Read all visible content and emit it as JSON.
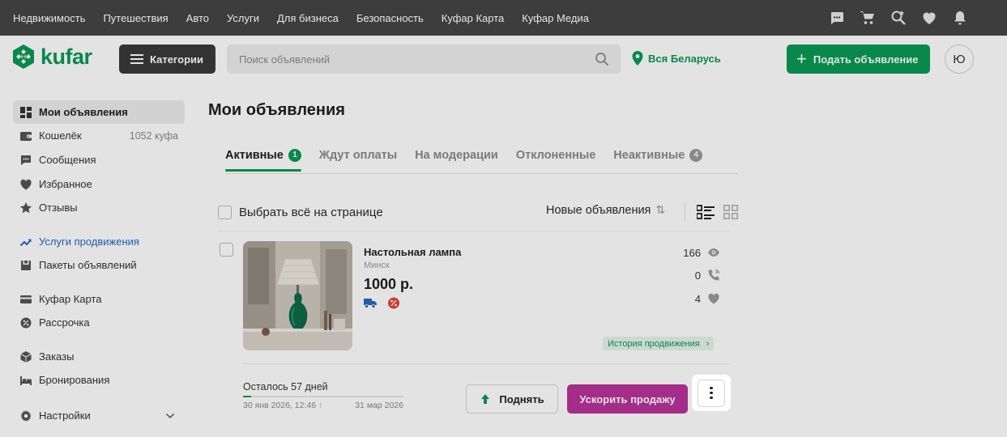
{
  "topnav": {
    "items": [
      "Недвижимость",
      "Путешествия",
      "Авто",
      "Услуги",
      "Для бизнеса",
      "Безопасность",
      "Куфар Карта",
      "Куфар Медиа"
    ],
    "icons": [
      "chat-icon",
      "cart-icon",
      "saved-search-icon",
      "heart-icon",
      "bell-icon"
    ]
  },
  "header": {
    "logo_text": "kufar",
    "categories_label": "Категории",
    "search_placeholder": "Поиск объявлений",
    "region_label": "Вся Беларусь",
    "post_label": "Подать объявление",
    "avatar_letter": "Ю"
  },
  "sidebar": {
    "items": [
      {
        "label": "Мои объявления",
        "icon": "grid-icon"
      },
      {
        "label": "Кошелёк",
        "icon": "wallet-icon",
        "extra": "1052 куфа"
      },
      {
        "label": "Сообщения",
        "icon": "chat-icon"
      },
      {
        "label": "Избранное",
        "icon": "heart-icon"
      },
      {
        "label": "Отзывы",
        "icon": "star-icon"
      },
      {
        "label": "Услуги продвижения",
        "icon": "trend-up-icon"
      },
      {
        "label": "Пакеты объявлений",
        "icon": "package-icon"
      },
      {
        "label": "Куфар Карта",
        "icon": "card-icon"
      },
      {
        "label": "Рассрочка",
        "icon": "installment-icon"
      },
      {
        "label": "Заказы",
        "icon": "box-icon"
      },
      {
        "label": "Бронирования",
        "icon": "bed-icon"
      },
      {
        "label": "Настройки",
        "icon": "gear-icon"
      }
    ]
  },
  "main": {
    "title": "Мои объявления",
    "tabs": [
      {
        "label": "Активные",
        "badge": "1"
      },
      {
        "label": "Ждут оплаты"
      },
      {
        "label": "На модерации"
      },
      {
        "label": "Отклоненные"
      },
      {
        "label": "Неактивные",
        "badge": "4"
      }
    ],
    "select_all_label": "Выбрать всё на странице",
    "sort_label": "Новые объявления",
    "ad": {
      "title": "Настольная лампа",
      "city": "Минск",
      "price": "1000 р.",
      "views": "166",
      "calls": "0",
      "favorites": "4",
      "history_label": "История продвижения",
      "remaining_label": "Осталось 57 дней",
      "date_start": "30 янв 2026, 12:46",
      "date_end": "31 мар 2026",
      "progress": 0.05,
      "raise_label": "Поднять",
      "boost_label": "Ускорить продажу"
    }
  },
  "colors": {
    "brand_green": "#0a9955",
    "topbar": "#3d3d3d",
    "boost_purple": "#b8339a",
    "promo_blue": "#2667c4"
  }
}
